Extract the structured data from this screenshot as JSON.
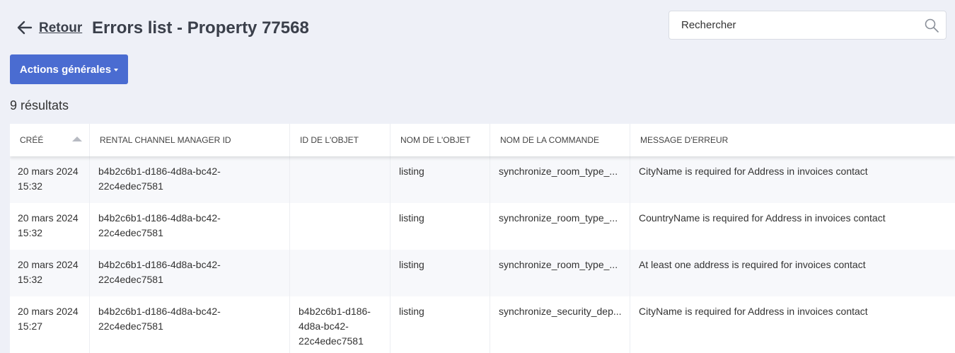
{
  "header": {
    "back_label": "Retour",
    "title": "Errors list - Property 77568"
  },
  "search": {
    "placeholder": "Rechercher",
    "icon": "search-icon"
  },
  "actions": {
    "label": "Actions générales"
  },
  "results_count": "9 résultats",
  "colors": {
    "accent": "#4a6cd1",
    "background": "#eef0f7"
  },
  "table": {
    "columns": [
      "Créé",
      "Rental Channel Manager ID",
      "ID de l'objet",
      "Nom de l'objet",
      "Nom de la commande",
      "Message d'erreur"
    ],
    "sorted_column": "Créé",
    "sort_direction": "ascending",
    "rows": [
      {
        "created_date": "20 mars 2024",
        "created_time": "15:32",
        "rcm_id_1": "b4b2c6b1-d186-4d8a-bc42-",
        "rcm_id_2": "22c4edec7581",
        "object_id_1": "",
        "object_id_2": "",
        "object_id_3": "",
        "object_name": "listing",
        "command_name": "synchronize_room_type_...",
        "error_message": "CityName is required for Address in invoices contact"
      },
      {
        "created_date": "20 mars 2024",
        "created_time": "15:32",
        "rcm_id_1": "b4b2c6b1-d186-4d8a-bc42-",
        "rcm_id_2": "22c4edec7581",
        "object_id_1": "",
        "object_id_2": "",
        "object_id_3": "",
        "object_name": "listing",
        "command_name": "synchronize_room_type_...",
        "error_message": "CountryName is required for Address in invoices contact"
      },
      {
        "created_date": "20 mars 2024",
        "created_time": "15:32",
        "rcm_id_1": "b4b2c6b1-d186-4d8a-bc42-",
        "rcm_id_2": "22c4edec7581",
        "object_id_1": "",
        "object_id_2": "",
        "object_id_3": "",
        "object_name": "listing",
        "command_name": "synchronize_room_type_...",
        "error_message": "At least one address is required for invoices contact"
      },
      {
        "created_date": "20 mars 2024",
        "created_time": "15:27",
        "rcm_id_1": "b4b2c6b1-d186-4d8a-bc42-",
        "rcm_id_2": "22c4edec7581",
        "object_id_1": "b4b2c6b1-d186-",
        "object_id_2": "4d8a-bc42-",
        "object_id_3": "22c4edec7581",
        "object_name": "listing",
        "command_name": "synchronize_security_dep...",
        "error_message": "CityName is required for Address in invoices contact"
      }
    ]
  }
}
